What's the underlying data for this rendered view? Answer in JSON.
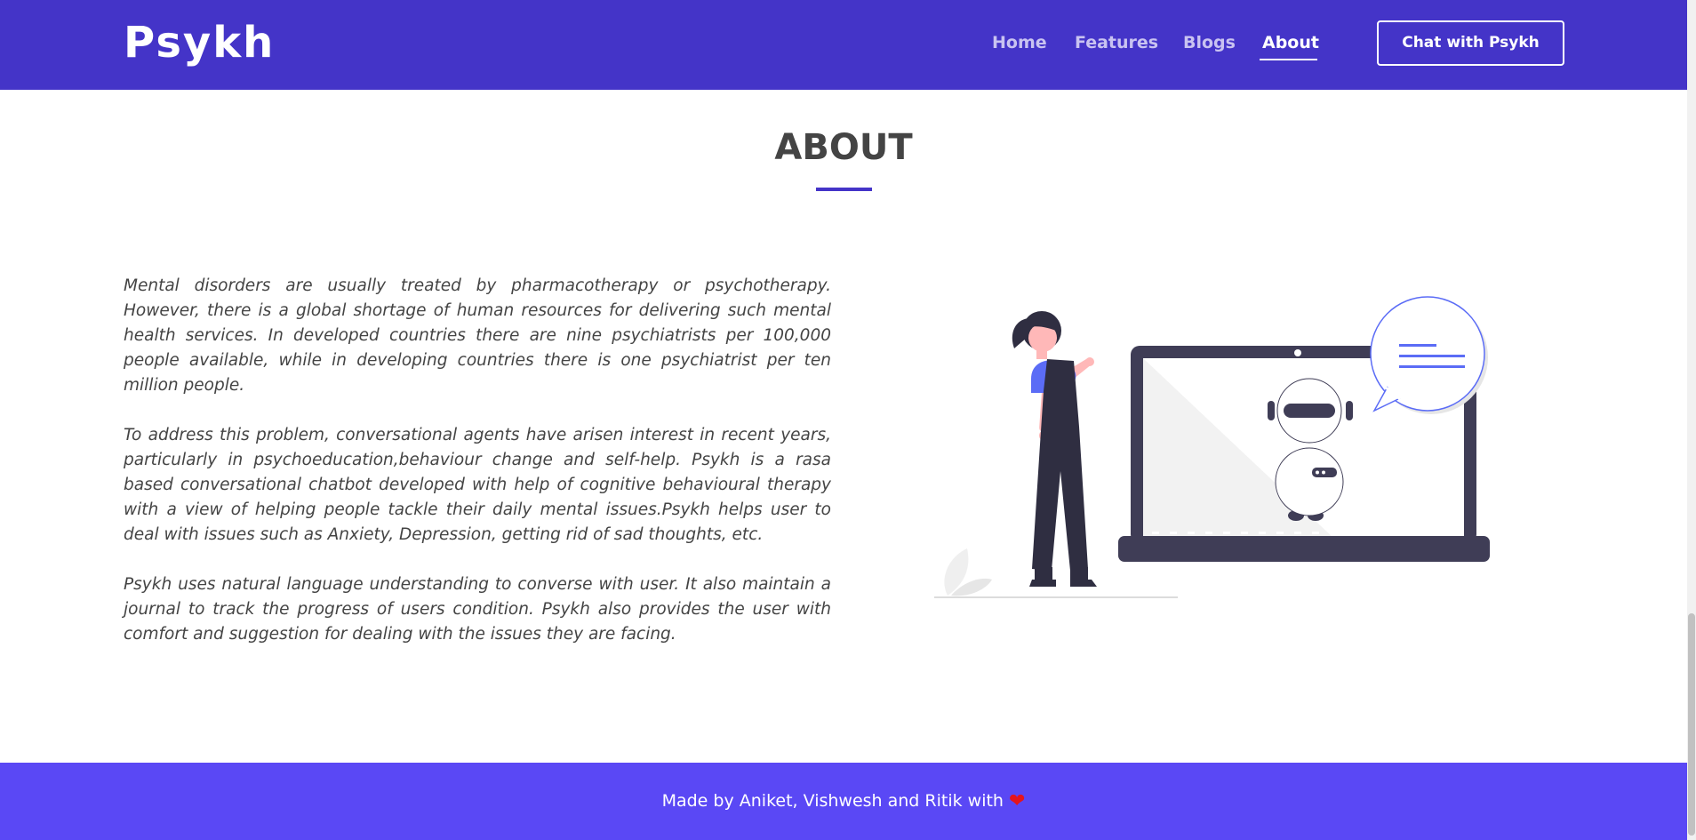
{
  "navbar": {
    "brand": "Psykh",
    "links": [
      {
        "label": "Home"
      },
      {
        "label": "Features"
      },
      {
        "label": "Blogs"
      },
      {
        "label": "About",
        "active": true
      }
    ],
    "cta_label": "Chat with Psykh"
  },
  "about": {
    "title": "ABOUT",
    "paragraphs": [
      "Mental disorders are usually treated by pharmacotherapy or psychotherapy. However, there is a global shortage of human resources for delivering such mental health services. In developed countries there are nine psychiatrists per 100,000 people available, while in developing countries there is one psychiatrist per ten million people.",
      "To address this problem, conversational agents have arisen interest in recent years, particularly in psychoeducation,behaviour change and self-help. Psykh is a rasa based conversational chatbot developed with help of cognitive behavioural therapy with a view of helping people tackle their daily mental issues.Psykh helps user to deal with issues such as Anxiety, Depression, getting rid of sad thoughts, etc.",
      "Psykh uses natural language understanding to converse with user. It also maintain a journal to track the progress of users condition. Psykh also provides the user with comfort and suggestion for dealing with the issues they are facing."
    ]
  },
  "footer": {
    "text": "Made by Aniket, Vishwesh and Ritik with",
    "icon": "heart-icon"
  },
  "colors": {
    "nav_bg": "#4434c8",
    "footer_bg": "#5a48f5",
    "accent": "#5b6cf6",
    "heart": "#e5141c"
  }
}
